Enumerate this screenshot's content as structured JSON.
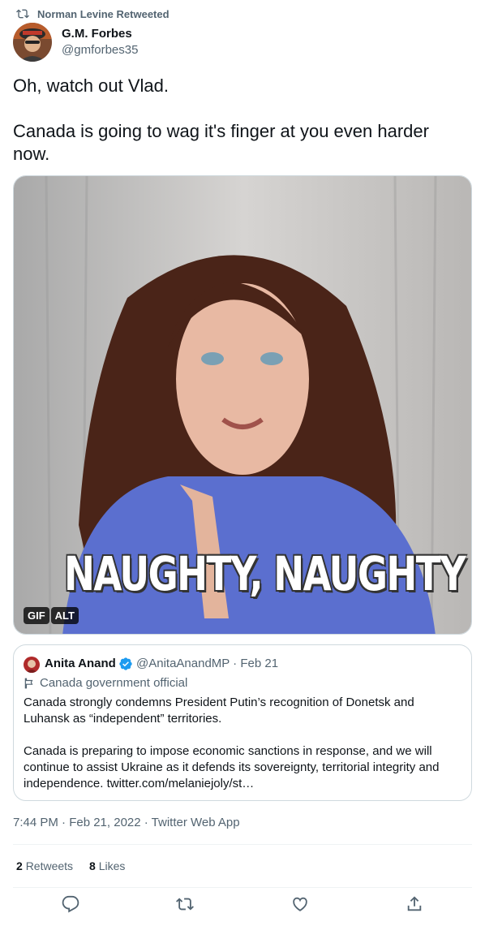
{
  "retweet_banner": {
    "text": "Norman Levine Retweeted"
  },
  "author": {
    "name": "G.M. Forbes",
    "handle": "@gmforbes35"
  },
  "tweet": {
    "text": "Oh, watch out Vlad.\n\nCanada is going to wag it's finger at you even harder now."
  },
  "media": {
    "caption": "NAUGHTY, NAUGHTY",
    "badges": [
      "GIF",
      "ALT"
    ]
  },
  "quoted_tweet": {
    "name": "Anita Anand",
    "handle_date": "@AnitaAnandMP · Feb 21",
    "label": "Canada government official",
    "text": "Canada strongly condemns President Putin’s recognition of Donetsk and Luhansk as “independent” territories.\n\nCanada is preparing to impose economic sanctions in response, and we will continue to assist Ukraine as it defends its sovereignty, territorial integrity and independence. twitter.com/melaniejoly/st…"
  },
  "timestamp": "7:44 PM · Feb 21, 2022 · Twitter Web App",
  "stats": {
    "retweets_count": "2",
    "retweets_label": "Retweets",
    "likes_count": "8",
    "likes_label": "Likes"
  },
  "colors": {
    "text": "#0f1419",
    "secondary": "#536471",
    "verified": "#1d9bf0",
    "border": "#cfd9de"
  },
  "icons": [
    "retweet-icon",
    "verified-icon",
    "flag-icon",
    "reply-icon",
    "retweet-icon",
    "like-icon",
    "share-icon"
  ]
}
